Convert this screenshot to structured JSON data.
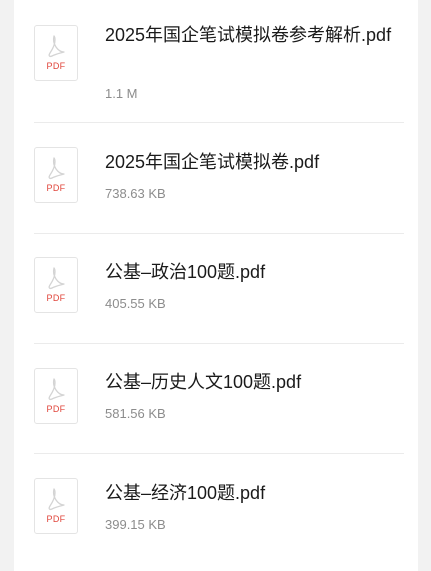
{
  "files": [
    {
      "name": "2025年国企笔试模拟卷参考解析.pdf",
      "size": "1.1 M",
      "type_label": "PDF"
    },
    {
      "name": "2025年国企笔试模拟卷.pdf",
      "size": "738.63 KB",
      "type_label": "PDF"
    },
    {
      "name": "公基–政治100题.pdf",
      "size": "405.55 KB",
      "type_label": "PDF"
    },
    {
      "name": "公基–历史人文100题.pdf",
      "size": "581.56 KB",
      "type_label": "PDF"
    },
    {
      "name": "公基–经济100题.pdf",
      "size": "399.15 KB",
      "type_label": "PDF"
    }
  ],
  "colors": {
    "background": "#f2f2f2",
    "card": "#ffffff",
    "pdf_accent": "#e0443a",
    "name_text": "#1a1a1a",
    "size_text": "#8c8c8c"
  },
  "icon": "pdf-file-icon"
}
